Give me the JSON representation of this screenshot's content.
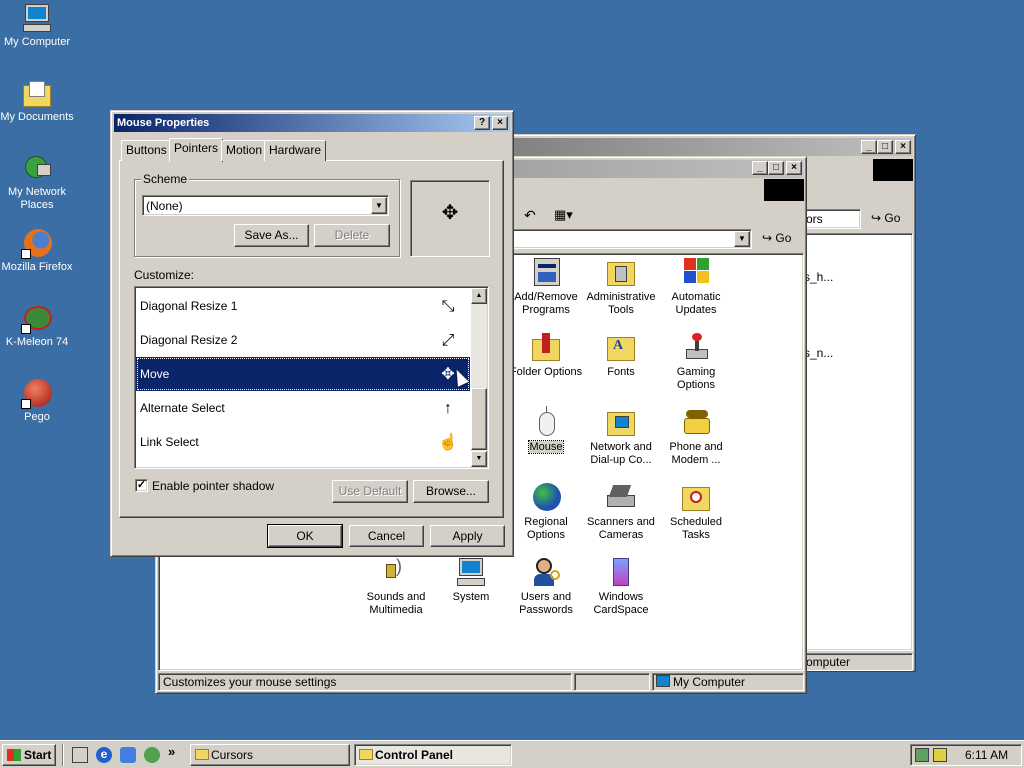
{
  "desktop": {
    "icons": [
      {
        "label": "My Computer",
        "icon": "my-computer-icon"
      },
      {
        "label": "My Documents",
        "icon": "my-documents-icon"
      },
      {
        "label": "My Network Places",
        "icon": "network-places-icon"
      },
      {
        "label": "Mozilla Firefox",
        "icon": "firefox-icon"
      },
      {
        "label": "K-Meleon 74",
        "icon": "k-meleon-icon"
      },
      {
        "label": "Pego",
        "icon": "pego-icon"
      }
    ]
  },
  "back_window": {
    "address_partial": "ors",
    "go_label": "Go",
    "items_partial": [
      "s_h...",
      "s_n..."
    ],
    "status_partial": "omputer"
  },
  "control_panel": {
    "go_label": "Go",
    "items": [
      {
        "label": "Add/Remove Programs",
        "icon": "add-remove-programs-icon"
      },
      {
        "label": "Administrative Tools",
        "icon": "administrative-tools-icon"
      },
      {
        "label": "Automatic Updates",
        "icon": "automatic-updates-icon"
      },
      {
        "label": "Folder Options",
        "icon": "folder-options-icon"
      },
      {
        "label": "Fonts",
        "icon": "fonts-icon"
      },
      {
        "label": "Gaming Options",
        "icon": "gaming-options-icon"
      },
      {
        "label": "Mouse",
        "icon": "mouse-icon"
      },
      {
        "label": "Network and Dial-up Co...",
        "icon": "network-dialup-icon"
      },
      {
        "label": "Phone and Modem ...",
        "icon": "phone-modem-icon"
      },
      {
        "label": "Regional Options",
        "icon": "regional-options-icon"
      },
      {
        "label": "Scanners and Cameras",
        "icon": "scanners-cameras-icon"
      },
      {
        "label": "Scheduled Tasks",
        "icon": "scheduled-tasks-icon"
      },
      {
        "label": "Sounds and Multimedia",
        "icon": "sounds-multimedia-icon"
      },
      {
        "label": "System",
        "icon": "system-icon"
      },
      {
        "label": "Users and Passwords",
        "icon": "users-passwords-icon"
      },
      {
        "label": "Windows CardSpace",
        "icon": "cardspace-icon"
      }
    ],
    "status_left": "Customizes your mouse settings",
    "status_right": "My Computer"
  },
  "dialog": {
    "title": "Mouse Properties",
    "help_btn": "?",
    "close_btn": "×",
    "tabs": [
      "Buttons",
      "Pointers",
      "Motion",
      "Hardware"
    ],
    "active_tab": "Pointers",
    "scheme_label": "Scheme",
    "scheme_value": "(None)",
    "save_as": "Save As...",
    "delete": "Delete",
    "customize_label": "Customize:",
    "pointers": [
      {
        "name": "Diagonal Resize 1",
        "glyph": "⤡"
      },
      {
        "name": "Diagonal Resize 2",
        "glyph": "⤢"
      },
      {
        "name": "Move",
        "glyph": "✥"
      },
      {
        "name": "Alternate Select",
        "glyph": "↑"
      },
      {
        "name": "Link Select",
        "glyph": "☝"
      }
    ],
    "selected_pointer": "Move",
    "shadow_label": "Enable pointer shadow",
    "shadow_checked": true,
    "use_default": "Use Default",
    "browse": "Browse...",
    "ok": "OK",
    "cancel": "Cancel",
    "apply": "Apply",
    "preview_glyph": "✥"
  },
  "taskbar": {
    "start": "Start",
    "tasks": [
      {
        "label": "Cursors",
        "active": false
      },
      {
        "label": "Control Panel",
        "active": true
      }
    ],
    "chevron": "»",
    "clock": "6:11 AM"
  },
  "colors": {
    "desktop": "#3a6ea5",
    "title_active": "#0a246a",
    "face": "#d4d0c8"
  }
}
